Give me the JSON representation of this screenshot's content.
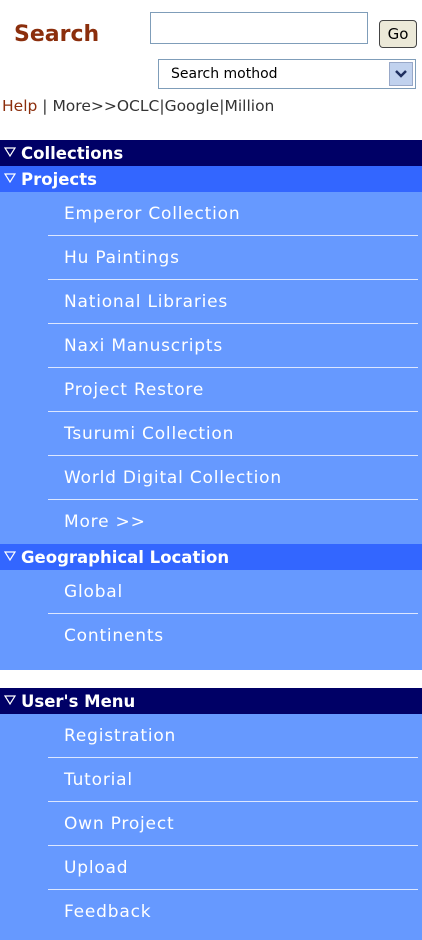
{
  "search": {
    "label": "Search",
    "input_value": "",
    "go_label": "Go",
    "method_selected": "Search mothod"
  },
  "links": {
    "help": "Help",
    "more": "More>>",
    "oclc": "OCLC",
    "google": "Google",
    "million": "Million"
  },
  "collections": {
    "header": "Collections",
    "projects": {
      "header": "Projects",
      "items": [
        {
          "label": "Emperor Collection"
        },
        {
          "label": "Hu Paintings"
        },
        {
          "label": "National Libraries"
        },
        {
          "label": "Naxi Manuscripts"
        },
        {
          "label": "Project Restore"
        },
        {
          "label": "Tsurumi Collection"
        },
        {
          "label": "World Digital Collection"
        },
        {
          "label": "More >>"
        }
      ]
    },
    "geo": {
      "header": "Geographical Location",
      "items": [
        {
          "label": "Global"
        },
        {
          "label": "Continents"
        }
      ]
    }
  },
  "user_menu": {
    "header": "User's Menu",
    "items": [
      {
        "label": "Registration"
      },
      {
        "label": "Tutorial"
      },
      {
        "label": "Own Project"
      },
      {
        "label": "Upload"
      },
      {
        "label": "Feedback"
      }
    ]
  },
  "colors": {
    "panel": "#6699ff",
    "header_dark": "#000066",
    "header_mid": "#3366ff",
    "search_label": "#8b2e0c"
  },
  "icons": {
    "collapse": "triangle-down-outline-icon",
    "dropdown": "chevron-down-icon"
  }
}
